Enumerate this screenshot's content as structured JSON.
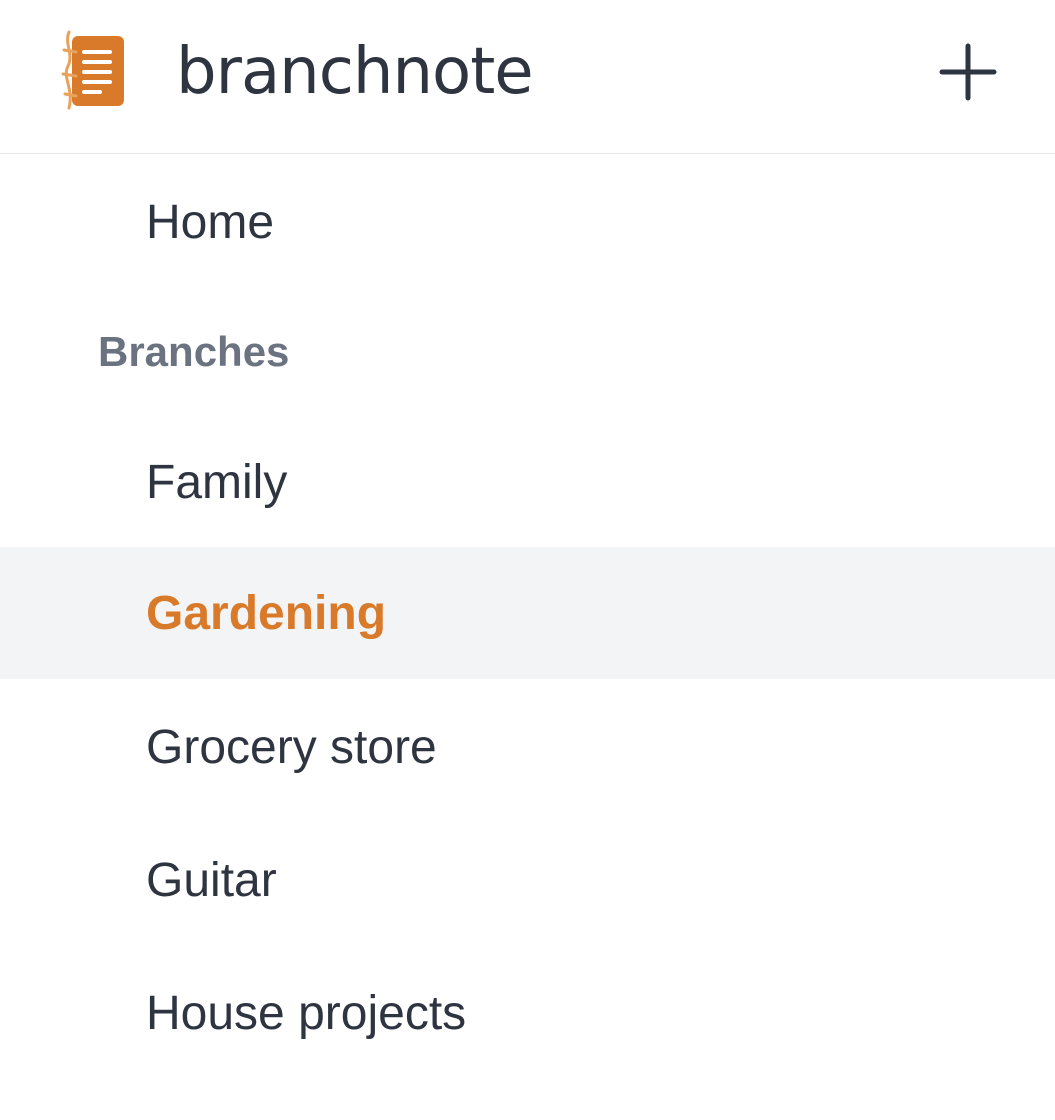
{
  "header": {
    "brand": "branchnote",
    "logo_icon": "notebook-icon",
    "add_icon": "plus-icon"
  },
  "nav": {
    "home_label": "Home",
    "section_label": "Branches",
    "branches": [
      {
        "label": "Family",
        "active": false
      },
      {
        "label": "Gardening",
        "active": true
      },
      {
        "label": "Grocery store",
        "active": false
      },
      {
        "label": "Guitar",
        "active": false
      },
      {
        "label": "House projects",
        "active": false
      }
    ]
  },
  "colors": {
    "accent": "#d97a2b",
    "text": "#2f3441",
    "muted": "#6b7280",
    "active_bg": "#f3f4f6",
    "divider": "#e5e7eb"
  }
}
